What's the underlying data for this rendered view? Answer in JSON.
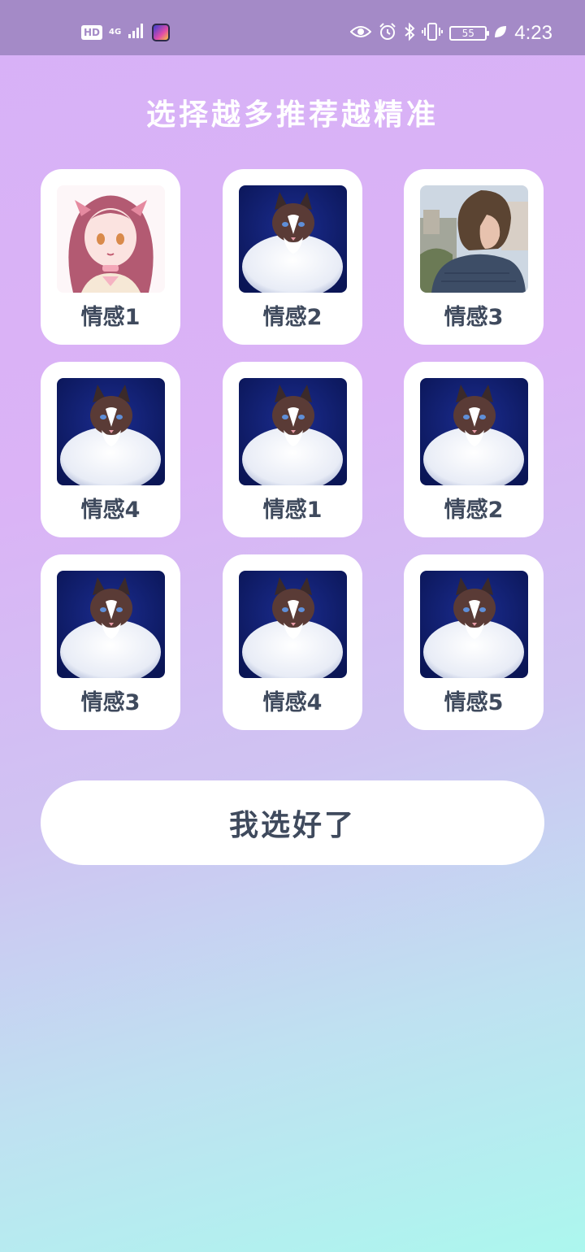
{
  "status_bar": {
    "hd": "HD",
    "network": "4G",
    "battery": "55",
    "time": "4:23"
  },
  "title": "选择越多推荐越精准",
  "cards": [
    {
      "label": "情感1",
      "image": "anime-girl"
    },
    {
      "label": "情感2",
      "image": "cat"
    },
    {
      "label": "情感3",
      "image": "person"
    },
    {
      "label": "情感4",
      "image": "cat"
    },
    {
      "label": "情感1",
      "image": "cat"
    },
    {
      "label": "情感2",
      "image": "cat"
    },
    {
      "label": "情感3",
      "image": "cat"
    },
    {
      "label": "情感4",
      "image": "cat"
    },
    {
      "label": "情感5",
      "image": "cat"
    }
  ],
  "confirm_button": "我选好了",
  "colors": {
    "status_bar": "#a48ac7",
    "label_text": "#3f4a5d",
    "card_bg": "#ffffff",
    "gradient_top": "#d7b1f7",
    "gradient_bottom": "#acf7ee"
  }
}
